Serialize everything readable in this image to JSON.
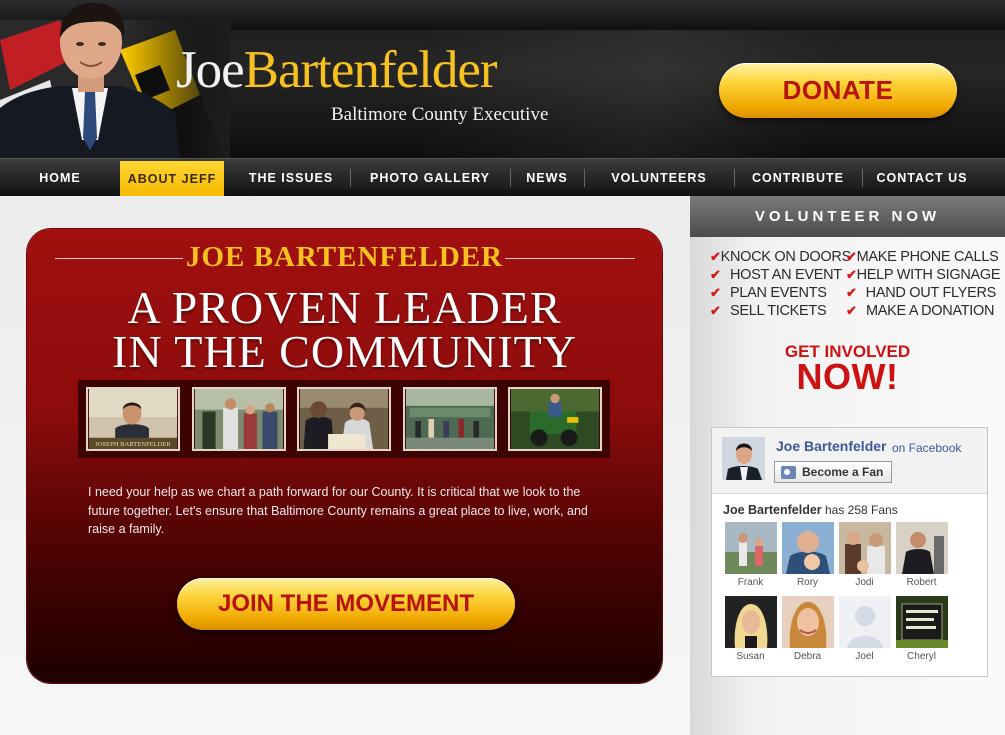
{
  "header": {
    "logo_first": "Joe",
    "logo_last": "Bartenfelder",
    "tagline": "Baltimore County Executive",
    "donate_label": "DONATE",
    "accent_color": "#f7c21f",
    "donate_text_color": "#b8120c"
  },
  "nav": {
    "items": [
      {
        "label": "HOME",
        "active": false
      },
      {
        "label": "ABOUT JEFF",
        "active": true
      },
      {
        "label": "THE ISSUES",
        "active": false
      },
      {
        "label": "PHOTO GALLERY",
        "active": false
      },
      {
        "label": "NEWS",
        "active": false
      },
      {
        "label": "VOLUNTEERS",
        "active": false
      },
      {
        "label": "CONTRIBUTE",
        "active": false
      },
      {
        "label": "CONTACT US",
        "active": false
      }
    ]
  },
  "hero": {
    "name": "JOE BARTENFELDER",
    "headline_line1": "A PROVEN LEADER",
    "headline_line2": "IN THE COMMUNITY",
    "body": "I need your help as we chart a path forward for our County. It is critical that we look to the future together. Let's ensure that Baltimore County remains a great place to live, work, and raise a family.",
    "cta_label": "JOIN THE MOVEMENT",
    "thumbnail_nameplate": "JOSEPH BARTENFELDER"
  },
  "sidebar": {
    "volunteer_heading": "VOLUNTEER NOW",
    "volunteer_items": [
      "KNOCK ON DOORS",
      "MAKE PHONE CALLS",
      "HOST AN EVENT",
      "HELP WITH SIGNAGE",
      "PLAN EVENTS",
      "HAND OUT FLYERS",
      "SELL TICKETS",
      "MAKE A DONATION"
    ],
    "check_icon": "check-icon",
    "get_involved": "GET INVOLVED",
    "get_involved_now": "NOW!"
  },
  "facebook": {
    "page_name": "Joe Bartenfelder",
    "on_facebook": "on Facebook",
    "fan_button": "Become a Fan",
    "count_name": "Joe Bartenfelder",
    "count_text": "has 258 Fans",
    "link_color": "#3b5998",
    "fans": [
      {
        "name": "Frank"
      },
      {
        "name": "Rory"
      },
      {
        "name": "Jodi"
      },
      {
        "name": "Robert"
      },
      {
        "name": "Susan"
      },
      {
        "name": "Debra"
      },
      {
        "name": "Joel"
      },
      {
        "name": "Cheryl"
      }
    ]
  }
}
